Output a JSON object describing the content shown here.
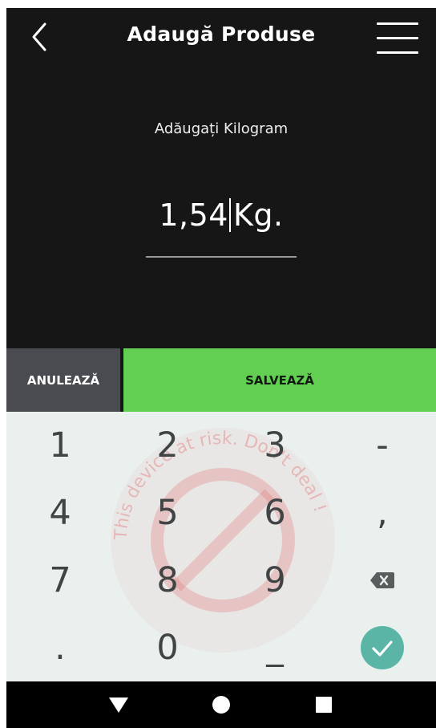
{
  "header": {
    "title": "Adaugă Produse",
    "back_icon": "chevron-left-icon",
    "menu_icon": "hamburger-menu-icon"
  },
  "form": {
    "label": "Adăugați Kilogram",
    "value": "1,54",
    "unit": "Kg."
  },
  "actions": {
    "cancel_label": "ANULEAZĂ",
    "save_label": "SALVEAZĂ"
  },
  "keypad": {
    "keys": [
      {
        "label": "1"
      },
      {
        "label": "2"
      },
      {
        "label": "3"
      },
      {
        "label": "-"
      },
      {
        "label": "4"
      },
      {
        "label": "5"
      },
      {
        "label": "6"
      },
      {
        "label": ","
      },
      {
        "label": "7"
      },
      {
        "label": "8"
      },
      {
        "label": "9"
      },
      {
        "icon": "backspace-icon"
      },
      {
        "label": "."
      },
      {
        "label": "0"
      },
      {
        "label": "_"
      },
      {
        "icon": "check-done-icon"
      }
    ]
  },
  "watermark": {
    "text": "This device at risk. Don't deal !"
  },
  "navbar": {
    "icons": [
      "back-triangle-icon",
      "home-circle-icon",
      "recents-square-icon"
    ]
  },
  "colors": {
    "header_bg": "#161616",
    "cancel_bg": "#4a4b50",
    "save_bg": "#63cf52",
    "keypad_bg": "#eaf0ee",
    "done_bg": "#5ab5a7",
    "watermark": "#e06a6a"
  }
}
